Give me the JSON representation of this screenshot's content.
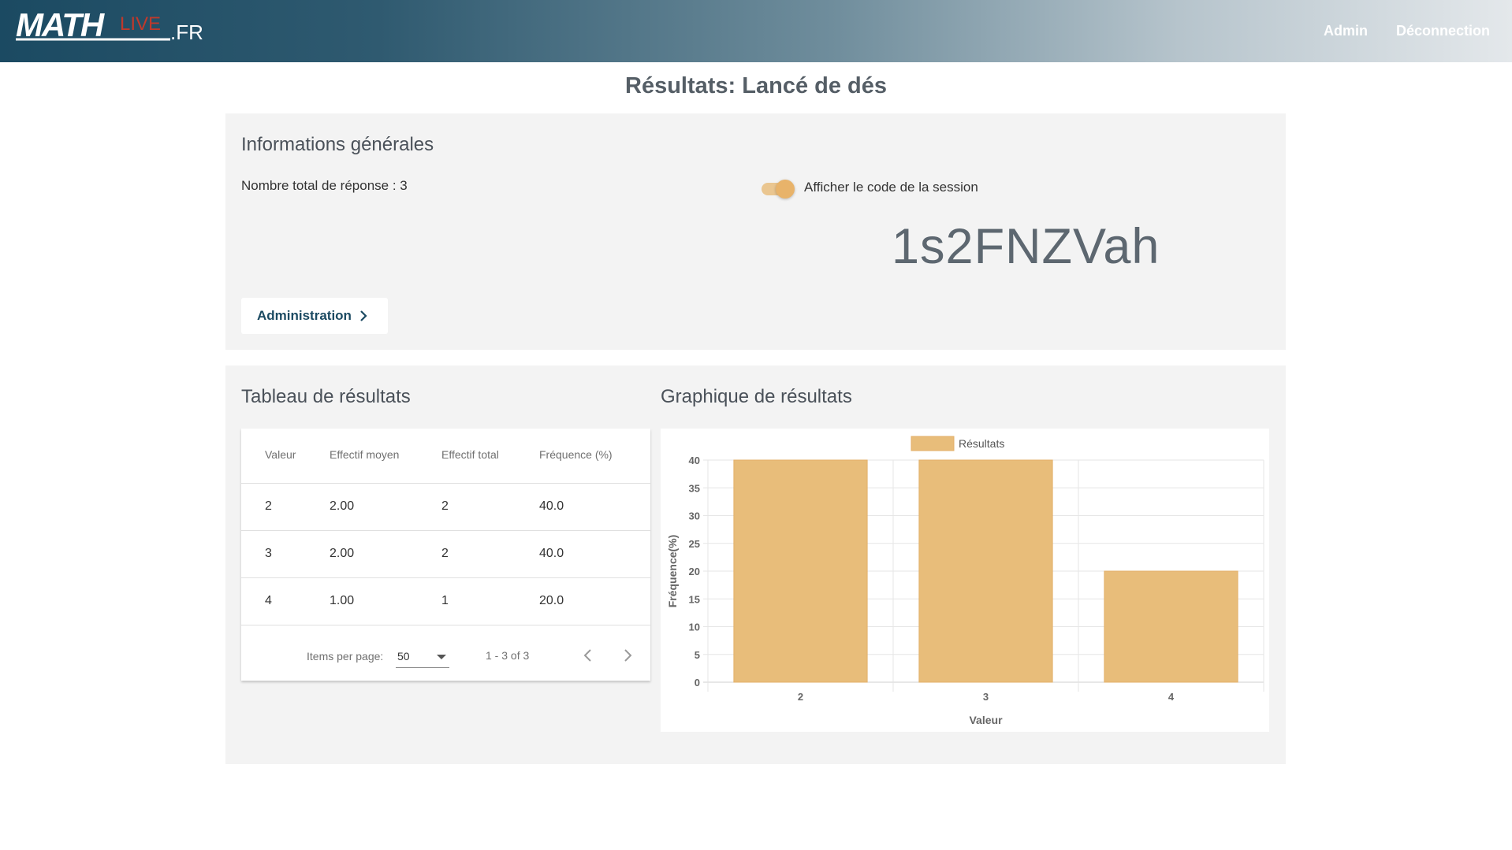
{
  "header": {
    "logo_text": "MATHLIVE.FR",
    "nav": [
      {
        "label": "Admin"
      },
      {
        "label": "Déconnection"
      }
    ]
  },
  "page": {
    "title": "Résultats: Lancé de dés"
  },
  "info": {
    "title": "Informations générales",
    "total_responses": "Nombre total de réponse : 3",
    "toggle_label": "Afficher le code de la session",
    "toggle_on": true,
    "session_code": "1s2FNZVah",
    "admin_button": "Administration"
  },
  "results": {
    "table_title": "Tableau de résultats",
    "chart_title": "Graphique de résultats",
    "columns": [
      "Valeur",
      "Effectif moyen",
      "Effectif total",
      "Fréquence (%)"
    ],
    "rows": [
      [
        "2",
        "2.00",
        "2",
        "40.0"
      ],
      [
        "3",
        "2.00",
        "2",
        "40.0"
      ],
      [
        "4",
        "1.00",
        "1",
        "20.0"
      ]
    ],
    "paginator": {
      "items_per_page_label": "Items per page:",
      "items_per_page": "50",
      "range": "1 - 3 of 3"
    }
  },
  "colors": {
    "accent": "#e8b36a",
    "bar": "#e8bd7a",
    "header_dark": "#1b4a62",
    "logo_red": "#c0392b"
  },
  "chart_data": {
    "type": "bar",
    "categories": [
      "2",
      "3",
      "4"
    ],
    "series": [
      {
        "name": "Résultats",
        "values": [
          40,
          40,
          20
        ]
      }
    ],
    "xlabel": "Valeur",
    "ylabel": "Fréquence(%)",
    "ylim": [
      0,
      40
    ],
    "yticks": [
      0,
      5,
      10,
      15,
      20,
      25,
      30,
      35,
      40
    ],
    "legend": "top",
    "grid": true
  }
}
